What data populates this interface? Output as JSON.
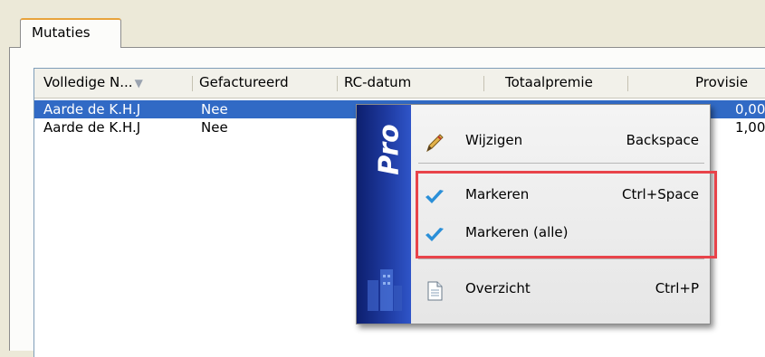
{
  "tab": {
    "label": "Mutaties"
  },
  "grid": {
    "columns": [
      "Volledige N...",
      "Gefactureerd",
      "RC-datum",
      "Totaalpremie",
      "Provisie"
    ],
    "rows": [
      {
        "name": "Aarde de K.H.J",
        "invoiced": "Nee",
        "provisie_partial": "0,00",
        "selected": true
      },
      {
        "name": "Aarde de K.H.J",
        "invoiced": "Nee",
        "provisie_partial": "1,00",
        "selected": false
      }
    ]
  },
  "context_menu": {
    "brand": "Pro",
    "items": [
      {
        "label": "Wijzigen",
        "shortcut": "Backspace",
        "icon": "pencil-icon"
      },
      {
        "label": "Markeren",
        "shortcut": "Ctrl+Space",
        "icon": "checkmark-icon"
      },
      {
        "label": "Markeren (alle)",
        "shortcut": "",
        "icon": "checkmark-icon"
      },
      {
        "label": "Overzicht",
        "shortcut": "Ctrl+P",
        "icon": "document-icon"
      }
    ]
  },
  "colors": {
    "selection": "#316ac5",
    "menu_sidebar": "#1e3aa0",
    "highlight_box": "#e8434a",
    "check": "#2a8fd8"
  }
}
